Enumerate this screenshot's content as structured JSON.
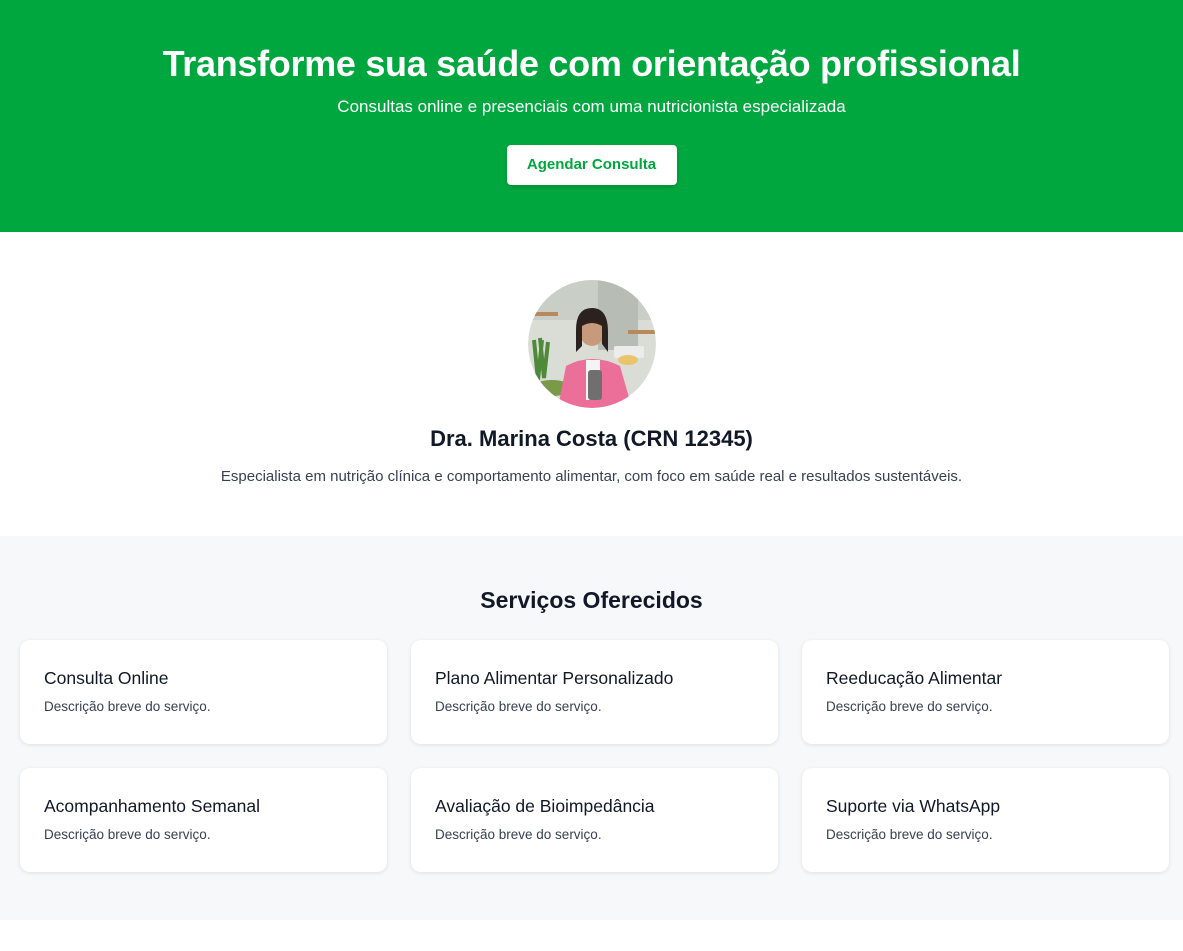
{
  "hero": {
    "title": "Transforme sua saúde com orientação profissional",
    "subtitle": "Consultas online e presenciais com uma nutricionista especializada",
    "cta_label": "Agendar Consulta",
    "bg_color": "#00a73e"
  },
  "profile": {
    "name": "Dra. Marina Costa (CRN 12345)",
    "bio": "Especialista em nutrição clínica e comportamento alimentar, com foco em saúde real e resultados sustentáveis."
  },
  "services": {
    "heading": "Serviços Oferecidos",
    "items": [
      {
        "title": "Consulta Online",
        "description": "Descrição breve do serviço."
      },
      {
        "title": "Plano Alimentar Personalizado",
        "description": "Descrição breve do serviço."
      },
      {
        "title": "Reeducação Alimentar",
        "description": "Descrição breve do serviço."
      },
      {
        "title": "Acompanhamento Semanal",
        "description": "Descrição breve do serviço."
      },
      {
        "title": "Avaliação de Bioimpedância",
        "description": "Descrição breve do serviço."
      },
      {
        "title": "Suporte via WhatsApp",
        "description": "Descrição breve do serviço."
      }
    ]
  }
}
